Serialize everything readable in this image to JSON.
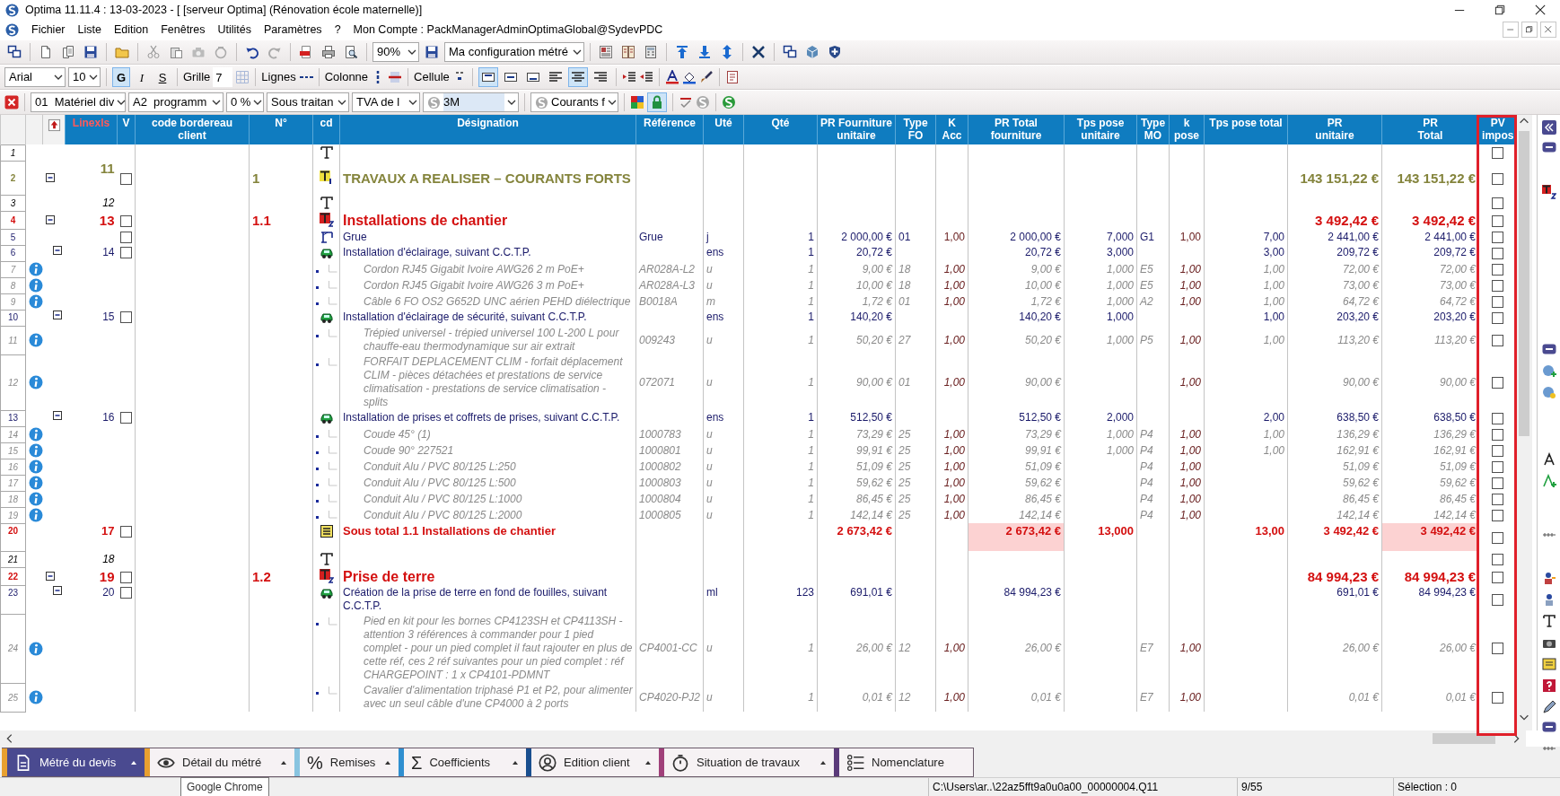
{
  "window": {
    "title": "Optima 11.11.4 : 13-03-2023 - [ [serveur Optima] (Rénovation école maternelle)]"
  },
  "menu": [
    "Fichier",
    "Liste",
    "Edition",
    "Fenêtres",
    "Utilités",
    "Paramètres",
    "?"
  ],
  "account": "Mon Compte : PackManagerAdminOptimaGlobal@SydevPDC",
  "toolbar": {
    "zoom": "90%",
    "configuration": "Ma configuration métré"
  },
  "format_bar": {
    "font": "Arial",
    "size": "10",
    "style_buttons": [
      {
        "label": "G",
        "on": true
      },
      {
        "label": "I",
        "on": false
      },
      {
        "label": "S",
        "on": false
      }
    ],
    "grid_label": "Grille",
    "grid_value": "7",
    "lines_label": "Lignes",
    "column_label": "Colonne",
    "cell_label": "Cellule",
    "border_buttons": [
      {
        "on": true
      },
      {
        "on": false
      },
      {
        "on": false
      }
    ],
    "align_buttons": [
      {
        "on": false
      },
      {
        "on": true
      },
      {
        "on": false
      }
    ]
  },
  "filter_bar": {
    "selects": [
      "01  Matériel div",
      "A2  programm",
      "0 %",
      "Sous traitan",
      "TVA de l"
    ],
    "lot": "3M",
    "section": "Courants f",
    "lock_on": true
  },
  "table": {
    "columns": [
      "Linexls",
      "V",
      "code bordereau client",
      "N°",
      "cd",
      "Désignation",
      "Référence",
      "Uté",
      "Qté",
      "PR Fourniture unitaire",
      "Type FO",
      "K Acc",
      "PR Total fourniture",
      "Tps pose unitaire",
      "Type MO",
      "k pose",
      "Tps pose total",
      "PR\nunitaire",
      "PR\nTotal",
      "PV\nimpos"
    ],
    "rows": [
      {
        "line": "1",
        "kind": "text",
        "pv_impose": false
      },
      {
        "line": "2",
        "kind": "title1",
        "linexls": "11",
        "v": false,
        "number": "1",
        "designation": "TRAVAUX A REALISER – COURANTS FORTS",
        "pr_unitaire": "143 151,22 €",
        "pr_total": "143 151,22 €",
        "pv_impose": false
      },
      {
        "line": "3",
        "kind": "text",
        "linexls": "12",
        "pv_impose": false
      },
      {
        "line": "4",
        "kind": "title2",
        "linexls": "13",
        "v": false,
        "number": "1.1",
        "designation": "Installations de chantier",
        "pr_unitaire": "3 492,42 €",
        "pr_total": "3 492,42 €",
        "pv_impose": false
      },
      {
        "line": "5",
        "kind": "item",
        "v": false,
        "designation": "Grue",
        "reference": "Grue",
        "unit": "j",
        "quantity": "1",
        "pr_fourniture_unitaire": "2 000,00 €",
        "type_fo": "01",
        "k_acc": "1,00",
        "pr_total_fourniture": "2 000,00 €",
        "tps_pose_unitaire": "7,000",
        "type_mo": "G1",
        "k_pose": "1,00",
        "tps_pose_total": "7,00",
        "pr_unitaire": "2 441,00 €",
        "pr_total": "2 441,00 €",
        "pv_impose": false
      },
      {
        "line": "6",
        "kind": "ouvrage",
        "linexls": "14",
        "v": false,
        "designation": "Installation d'éclairage, suivant C.C.T.P.",
        "unit": "ens",
        "quantity": "1",
        "pr_fourniture_unitaire": "20,72 €",
        "pr_total_fourniture": "20,72 €",
        "tps_pose_unitaire": "3,000",
        "tps_pose_total": "3,00",
        "pr_unitaire": "209,72 €",
        "pr_total": "209,72 €",
        "pv_impose": false
      },
      {
        "line": "7",
        "kind": "article",
        "designation": "Cordon RJ45 Gigabit Ivoire AWG26 2 m PoE+",
        "reference": "AR028A-L2",
        "unit": "u",
        "quantity": "1",
        "pr_fourniture_unitaire": "9,00 €",
        "type_fo": "18",
        "k_acc": "1,00",
        "pr_total_fourniture": "9,00 €",
        "tps_pose_unitaire": "1,000",
        "type_mo": "E5",
        "k_pose": "1,00",
        "tps_pose_total": "1,00",
        "pr_unitaire": "72,00 €",
        "pr_total": "72,00 €",
        "pv_impose": false
      },
      {
        "line": "8",
        "kind": "article",
        "designation": "Cordon RJ45 Gigabit Ivoire AWG26 3 m PoE+",
        "reference": "AR028A-L3",
        "unit": "u",
        "quantity": "1",
        "pr_fourniture_unitaire": "10,00 €",
        "type_fo": "18",
        "k_acc": "1,00",
        "pr_total_fourniture": "10,00 €",
        "tps_pose_unitaire": "1,000",
        "type_mo": "E5",
        "k_pose": "1,00",
        "tps_pose_total": "1,00",
        "pr_unitaire": "73,00 €",
        "pr_total": "73,00 €",
        "pv_impose": false
      },
      {
        "line": "9",
        "kind": "article",
        "designation": "Câble 6 FO OS2 G652D UNC aérien PEHD diélectrique",
        "reference": "B0018A",
        "unit": "m",
        "quantity": "1",
        "pr_fourniture_unitaire": "1,72 €",
        "type_fo": "01",
        "k_acc": "1,00",
        "pr_total_fourniture": "1,72 €",
        "tps_pose_unitaire": "1,000",
        "type_mo": "A2",
        "k_pose": "1,00",
        "tps_pose_total": "1,00",
        "pr_unitaire": "64,72 €",
        "pr_total": "64,72 €",
        "pv_impose": false
      },
      {
        "line": "10",
        "kind": "ouvrage",
        "linexls": "15",
        "v": false,
        "designation": "Installation d'éclairage de sécurité, suivant C.C.T.P.",
        "unit": "ens",
        "quantity": "1",
        "pr_fourniture_unitaire": "140,20 €",
        "pr_total_fourniture": "140,20 €",
        "tps_pose_unitaire": "1,000",
        "tps_pose_total": "1,00",
        "pr_unitaire": "203,20 €",
        "pr_total": "203,20 €",
        "pv_impose": false
      },
      {
        "line": "11",
        "kind": "article",
        "designation": "Trépied universel - trépied universel 100 L-200 L pour chauffe-eau thermodynamique sur air extrait",
        "reference": "009243",
        "unit": "u",
        "quantity": "1",
        "pr_fourniture_unitaire": "50,20 €",
        "type_fo": "27",
        "k_acc": "1,00",
        "pr_total_fourniture": "50,20 €",
        "tps_pose_unitaire": "1,000",
        "type_mo": "P5",
        "k_pose": "1,00",
        "tps_pose_total": "1,00",
        "pr_unitaire": "113,20 €",
        "pr_total": "113,20 €",
        "pv_impose": false
      },
      {
        "line": "12",
        "kind": "article",
        "designation": "FORFAIT DEPLACEMENT CLIM - forfait déplacement CLIM - pièces détachées et prestations de service climatisation - prestations de service climatisation - splits",
        "reference": "072071",
        "unit": "u",
        "quantity": "1",
        "pr_fourniture_unitaire": "90,00 €",
        "type_fo": "01",
        "k_acc": "1,00",
        "pr_total_fourniture": "90,00 €",
        "k_pose": "1,00",
        "pr_unitaire": "90,00 €",
        "pr_total": "90,00 €",
        "pv_impose": false
      },
      {
        "line": "13",
        "kind": "ouvrage",
        "linexls": "16",
        "v": false,
        "designation": "Installation de prises et coffrets de prises, suivant C.C.T.P.",
        "unit": "ens",
        "quantity": "1",
        "pr_fourniture_unitaire": "512,50 €",
        "pr_total_fourniture": "512,50 €",
        "tps_pose_unitaire": "2,000",
        "tps_pose_total": "2,00",
        "pr_unitaire": "638,50 €",
        "pr_total": "638,50 €",
        "pv_impose": false
      },
      {
        "line": "14",
        "kind": "article",
        "designation": "Coude 45° (1)",
        "reference": "1000783",
        "unit": "u",
        "quantity": "1",
        "pr_fourniture_unitaire": "73,29 €",
        "type_fo": "25",
        "k_acc": "1,00",
        "pr_total_fourniture": "73,29 €",
        "tps_pose_unitaire": "1,000",
        "type_mo": "P4",
        "k_pose": "1,00",
        "tps_pose_total": "1,00",
        "pr_unitaire": "136,29 €",
        "pr_total": "136,29 €",
        "pv_impose": false
      },
      {
        "line": "15",
        "kind": "article",
        "designation": "Coude 90° 227521",
        "reference": "1000801",
        "unit": "u",
        "quantity": "1",
        "pr_fourniture_unitaire": "99,91 €",
        "type_fo": "25",
        "k_acc": "1,00",
        "pr_total_fourniture": "99,91 €",
        "tps_pose_unitaire": "1,000",
        "type_mo": "P4",
        "k_pose": "1,00",
        "tps_pose_total": "1,00",
        "pr_unitaire": "162,91 €",
        "pr_total": "162,91 €",
        "pv_impose": false
      },
      {
        "line": "16",
        "kind": "article",
        "designation": "Conduit Alu / PVC 80/125 L:250",
        "reference": "1000802",
        "unit": "u",
        "quantity": "1",
        "pr_fourniture_unitaire": "51,09 €",
        "type_fo": "25",
        "k_acc": "1,00",
        "pr_total_fourniture": "51,09 €",
        "type_mo": "P4",
        "k_pose": "1,00",
        "pr_unitaire": "51,09 €",
        "pr_total": "51,09 €",
        "pv_impose": false
      },
      {
        "line": "17",
        "kind": "article",
        "designation": "Conduit Alu / PVC 80/125 L:500",
        "reference": "1000803",
        "unit": "u",
        "quantity": "1",
        "pr_fourniture_unitaire": "59,62 €",
        "type_fo": "25",
        "k_acc": "1,00",
        "pr_total_fourniture": "59,62 €",
        "type_mo": "P4",
        "k_pose": "1,00",
        "pr_unitaire": "59,62 €",
        "pr_total": "59,62 €",
        "pv_impose": false
      },
      {
        "line": "18",
        "kind": "article",
        "designation": "Conduit Alu / PVC 80/125 L:1000",
        "reference": "1000804",
        "unit": "u",
        "quantity": "1",
        "pr_fourniture_unitaire": "86,45 €",
        "type_fo": "25",
        "k_acc": "1,00",
        "pr_total_fourniture": "86,45 €",
        "type_mo": "P4",
        "k_pose": "1,00",
        "pr_unitaire": "86,45 €",
        "pr_total": "86,45 €",
        "pv_impose": false
      },
      {
        "line": "19",
        "kind": "article",
        "designation": "Conduit Alu / PVC 80/125 L:2000",
        "reference": "1000805",
        "unit": "u",
        "quantity": "1",
        "pr_fourniture_unitaire": "142,14 €",
        "type_fo": "25",
        "k_acc": "1,00",
        "pr_total_fourniture": "142,14 €",
        "type_mo": "P4",
        "k_pose": "1,00",
        "pr_unitaire": "142,14 €",
        "pr_total": "142,14 €",
        "pv_impose": false
      },
      {
        "line": "20",
        "kind": "subtotal",
        "linexls": "17",
        "v": false,
        "designation": "Sous total 1.1 Installations de chantier",
        "pr_fourniture_unitaire": "2 673,42 €",
        "pr_total_fourniture": "2 673,42 €",
        "tps_pose_unitaire": "13,000",
        "tps_pose_total": "13,00",
        "pr_unitaire": "3 492,42 €",
        "pr_total": "3 492,42 €",
        "pv_impose": false
      },
      {
        "line": "21",
        "kind": "text",
        "linexls": "18",
        "pv_impose": false
      },
      {
        "line": "22",
        "kind": "title2",
        "linexls": "19",
        "v": false,
        "number": "1.2",
        "designation": "Prise de terre",
        "pr_unitaire": "84 994,23 €",
        "pr_total": "84 994,23 €",
        "pv_impose": false
      },
      {
        "line": "23",
        "kind": "ouvrage",
        "linexls": "20",
        "v": false,
        "designation": "Création de la prise de terre en fond de fouilles, suivant C.C.T.P.",
        "unit": "ml",
        "quantity": "123",
        "pr_fourniture_unitaire": "691,01 €",
        "pr_total_fourniture": "84 994,23 €",
        "pr_unitaire": "691,01 €",
        "pr_total": "84 994,23 €",
        "pv_impose": false
      },
      {
        "line": "24",
        "kind": "article",
        "designation": "Pied en kit pour les bornes CP4123SH et CP4113SH - attention 3 références à commander pour 1 pied complet - pour un pied complet il faut rajouter en plus de cette réf, ces 2 réf suivantes pour un pied complet : réf CHARGEPOINT : 1 x CP4101-PDMNT",
        "reference": "CP4001-CC",
        "unit": "u",
        "quantity": "1",
        "pr_fourniture_unitaire": "26,00 €",
        "type_fo": "12",
        "k_acc": "1,00",
        "pr_total_fourniture": "26,00 €",
        "type_mo": "E7",
        "k_pose": "1,00",
        "pr_unitaire": "26,00 €",
        "pr_total": "26,00 €",
        "pv_impose": false
      },
      {
        "line": "25",
        "kind": "article",
        "designation": "Cavalier d'alimentation triphasé P1 et P2, pour alimenter avec un seul câble d'une CP4000 à 2 ports",
        "reference": "CP4020-PJ2",
        "unit": "u",
        "quantity": "1",
        "pr_fourniture_unitaire": "0,01 €",
        "type_fo": "12",
        "k_acc": "1,00",
        "pr_total_fourniture": "0,01 €",
        "type_mo": "E7",
        "k_pose": "1,00",
        "pr_unitaire": "0,01 €",
        "pr_total": "0,01 €",
        "pv_impose": false
      }
    ]
  },
  "bottom_tabs": [
    {
      "label": "Métré du devis",
      "kind": "document",
      "selected": true,
      "dropdown": true,
      "color": "#e8a030"
    },
    {
      "label": "Détail du métré",
      "kind": "eye",
      "selected": false,
      "dropdown": true,
      "color": "#e8a030"
    },
    {
      "label": "Remises",
      "kind": "symbol",
      "symbol": "%",
      "selected": false,
      "dropdown": true,
      "color": "#88c4e0"
    },
    {
      "label": "Coefficients",
      "kind": "symbol",
      "symbol": "Σ",
      "selected": false,
      "dropdown": true,
      "color": "#2f8fd0"
    },
    {
      "label": "Edition client",
      "kind": "person",
      "selected": false,
      "dropdown": true,
      "color": "#1a4f8f"
    },
    {
      "label": "Situation de travaux",
      "kind": "timer",
      "selected": false,
      "dropdown": true,
      "color": "#a0407a"
    },
    {
      "label": "Nomenclature",
      "kind": "list",
      "selected": false,
      "dropdown": false,
      "color": "#5a3a7a"
    }
  ],
  "tooltip": "Google Chrome",
  "status_bar": [
    "C:\\Users\\ar..\\22az5fft9a0u0a00_00000004.Q11",
    "9/55",
    "Sélection : 0"
  ]
}
